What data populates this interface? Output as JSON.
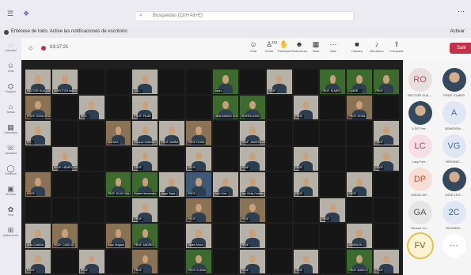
{
  "window": {
    "menu_icon": "☰",
    "teams_icon": "❖",
    "search_icon": "magnifier-icon",
    "search_text": "Busquedas (Ctrl+Alt+E)",
    "more_icon": "⋯"
  },
  "notification": {
    "text": "Entérese de todo. Active las notificaciones de escritorio",
    "action": "Activar"
  },
  "rail": [
    {
      "icon": "◌",
      "label": "Actividad"
    },
    {
      "icon": "☺",
      "label": "Chat"
    },
    {
      "icon": "⛭",
      "label": "Equipos"
    },
    {
      "icon": "⌂",
      "label": "Tareas"
    },
    {
      "icon": "▦",
      "label": "Calendario"
    },
    {
      "icon": "☏",
      "label": "Llamadas"
    },
    {
      "icon": "◯",
      "label": "OneDrive"
    },
    {
      "icon": "▣",
      "label": "Mi clase"
    },
    {
      "icon": "✿",
      "label": "Viva"
    },
    {
      "icon": "⊞",
      "label": "Aplicaciones"
    }
  ],
  "toolbar": {
    "timer": "03:17:21",
    "tools": [
      {
        "icon": "☺",
        "label": "Chat"
      },
      {
        "icon": "♙",
        "label": "Gente",
        "badge": "112"
      },
      {
        "icon": "✋",
        "label": "Participar"
      },
      {
        "icon": "☻",
        "label": "Reaccionar"
      },
      {
        "icon": "▦",
        "label": "Vista"
      },
      {
        "icon": "⋯",
        "label": "Más"
      },
      {
        "icon": "■",
        "label": "Cámara"
      },
      {
        "icon": "♪",
        "label": "Micrófono"
      },
      {
        "icon": "⇪",
        "label": "Compartir"
      }
    ],
    "leave": "Salir"
  },
  "tiles": [
    {
      "name": "RECTOR GUILLERMO",
      "style": "lite"
    },
    {
      "name": "DIRECTOR MARCO",
      "style": "lite"
    },
    {
      "name": "",
      "style": "off"
    },
    {
      "name": "",
      "style": "off"
    },
    {
      "name": "DIO...",
      "style": "lite"
    },
    {
      "name": "",
      "style": "off"
    },
    {
      "name": "",
      "style": "off"
    },
    {
      "name": "Arturo",
      "style": "grn"
    },
    {
      "name": "",
      "style": "off"
    },
    {
      "name": "PROF.",
      "style": "lite"
    },
    {
      "name": "",
      "style": "off"
    },
    {
      "name": "PROF. ELMER",
      "style": "grn"
    },
    {
      "name": "ELMER ...",
      "style": "grn"
    },
    {
      "name": "PROF.",
      "style": "grn"
    },
    {
      "name": "PROF. ROSA SEGOV",
      "style": "tan"
    },
    {
      "name": "",
      "style": "off"
    },
    {
      "name": "PRO...",
      "style": "lite"
    },
    {
      "name": "",
      "style": "off"
    },
    {
      "name": "PROF. PILAR",
      "style": "lite"
    },
    {
      "name": "",
      "style": "off"
    },
    {
      "name": "",
      "style": "off"
    },
    {
      "name": "LIMA RAMOS GONZ",
      "style": "grn"
    },
    {
      "name": "RIVERA JOSE",
      "style": "grn"
    },
    {
      "name": "",
      "style": "off"
    },
    {
      "name": "PROF.",
      "style": "lite"
    },
    {
      "name": "",
      "style": "off"
    },
    {
      "name": "PROF. ROSA",
      "style": "tan"
    },
    {
      "name": "",
      "style": "off"
    },
    {
      "name": "PR...",
      "style": "lite"
    },
    {
      "name": "",
      "style": "off"
    },
    {
      "name": "",
      "style": "off"
    },
    {
      "name": "MONICA",
      "style": "tan"
    },
    {
      "name": "Ricardo Gutiérrez",
      "style": "lite"
    },
    {
      "name": "PROF. MARIA",
      "style": "lite"
    },
    {
      "name": "PROF. ROSA",
      "style": "tan"
    },
    {
      "name": "",
      "style": "off"
    },
    {
      "name": "PROF. JAVIER LUIS",
      "style": "lite"
    },
    {
      "name": "",
      "style": "off"
    },
    {
      "name": "",
      "style": "off"
    },
    {
      "name": "",
      "style": "off"
    },
    {
      "name": "",
      "style": "off"
    },
    {
      "name": "PROF.",
      "style": "lite"
    },
    {
      "name": "",
      "style": "off"
    },
    {
      "name": "PROF. HENRY DIAZ",
      "style": "lite"
    },
    {
      "name": "",
      "style": "off"
    },
    {
      "name": "",
      "style": "off"
    },
    {
      "name": "PROF.",
      "style": "lite"
    },
    {
      "name": "",
      "style": "off"
    },
    {
      "name": "PROF.",
      "style": "lite"
    },
    {
      "name": "",
      "style": "off"
    },
    {
      "name": "PROF.",
      "style": "lite"
    },
    {
      "name": "",
      "style": "off"
    },
    {
      "name": "PROF.",
      "style": "lite"
    },
    {
      "name": "",
      "style": "off"
    },
    {
      "name": "",
      "style": "off"
    },
    {
      "name": "PROF.",
      "style": "lite"
    },
    {
      "name": "PROF.",
      "style": "tan"
    },
    {
      "name": "",
      "style": "off"
    },
    {
      "name": "",
      "style": "off"
    },
    {
      "name": "PROF. ELVIS SALVO",
      "style": "grn"
    },
    {
      "name": "Rafael Hernández",
      "style": "grn"
    },
    {
      "name": "Jorge Tapia",
      "style": "lite"
    },
    {
      "name": "PROF.",
      "style": "blu"
    },
    {
      "name": "Ruth Soto",
      "style": "lite"
    },
    {
      "name": "Dra. Betty Castillo",
      "style": "lite"
    },
    {
      "name": "",
      "style": "off"
    },
    {
      "name": "PROF.",
      "style": "lite"
    },
    {
      "name": "",
      "style": "off"
    },
    {
      "name": "PROF.",
      "style": "lite"
    },
    {
      "name": "",
      "style": "off"
    },
    {
      "name": "",
      "style": "off"
    },
    {
      "name": "",
      "style": "off"
    },
    {
      "name": "",
      "style": "off"
    },
    {
      "name": "",
      "style": "off"
    },
    {
      "name": "PROF.",
      "style": "lite"
    },
    {
      "name": "",
      "style": "off"
    },
    {
      "name": "PROF.",
      "style": "tan"
    },
    {
      "name": "",
      "style": "off"
    },
    {
      "name": "PROF.",
      "style": "tan"
    },
    {
      "name": "",
      "style": "off"
    },
    {
      "name": "",
      "style": "off"
    },
    {
      "name": "PROF.",
      "style": "lite"
    },
    {
      "name": "",
      "style": "off"
    },
    {
      "name": "",
      "style": "off"
    },
    {
      "name": "ANA CANDIA",
      "style": "lite"
    },
    {
      "name": "PROF. CARLOS",
      "style": "tan"
    },
    {
      "name": "",
      "style": "off"
    },
    {
      "name": "Rosa Vergara",
      "style": "tan"
    },
    {
      "name": "PROF. ANDRES",
      "style": "grn"
    },
    {
      "name": "",
      "style": "off"
    },
    {
      "name": "Daniel Mora",
      "style": "lite"
    },
    {
      "name": "",
      "style": "off"
    },
    {
      "name": "PROF.",
      "style": "lite"
    },
    {
      "name": "",
      "style": "off"
    },
    {
      "name": "",
      "style": "off"
    },
    {
      "name": "",
      "style": "off"
    },
    {
      "name": "ADMISION",
      "style": "lite"
    },
    {
      "name": "",
      "style": "off"
    },
    {
      "name": "PROF.",
      "style": "lite"
    },
    {
      "name": "",
      "style": "off"
    },
    {
      "name": "PROF.",
      "style": "lite"
    },
    {
      "name": "",
      "style": "off"
    },
    {
      "name": "PROF.",
      "style": "tan"
    },
    {
      "name": "",
      "style": "off"
    },
    {
      "name": "PROF. ELENA",
      "style": "grn"
    },
    {
      "name": "",
      "style": "off"
    },
    {
      "name": "PROF.",
      "style": "lite"
    },
    {
      "name": "",
      "style": "off"
    },
    {
      "name": "PROF.",
      "style": "lite"
    },
    {
      "name": "",
      "style": "off"
    },
    {
      "name": "PROF. MARCO",
      "style": "grn"
    },
    {
      "name": "PROF.",
      "style": "lite"
    }
  ],
  "people": [
    {
      "initials": "RO",
      "name": "RECTOR GUIL...",
      "bg": "#e8dede",
      "fg": "#b8476a"
    },
    {
      "initials": "",
      "name": "PROF. ELMER",
      "photo": true
    },
    {
      "initials": "",
      "name": "ILSE Ferr...",
      "photo": true
    },
    {
      "initials": "A",
      "name": "ADMISION...",
      "bg": "#dfe7f4",
      "fg": "#4a6db5"
    },
    {
      "initials": "LC",
      "name": "Lucy Ferr...",
      "bg": "#f6dde6",
      "fg": "#c0396b"
    },
    {
      "initials": "VG",
      "name": "VERONIC...",
      "bg": "#dfe7f4",
      "fg": "#4a6db5"
    },
    {
      "initials": "DP",
      "name": "DIEGO AP...",
      "bg": "#f6ded5",
      "fg": "#c8512e"
    },
    {
      "initials": "",
      "name": "JOSE LEO...",
      "photo": true
    },
    {
      "initials": "GA",
      "name": "Gerson Co...",
      "bg": "#e5e5e5",
      "fg": "#555555"
    },
    {
      "initials": "2C",
      "name": "25104003...",
      "bg": "#dfe7f4",
      "fg": "#3a68b3"
    },
    {
      "initials": "FV",
      "name": "",
      "bg": "#fbf3d6",
      "fg": "#7a6420",
      "ring": "#e5c046"
    },
    {
      "initials": "···",
      "name": "",
      "bg": "#ffffff",
      "fg": "#444444"
    }
  ]
}
